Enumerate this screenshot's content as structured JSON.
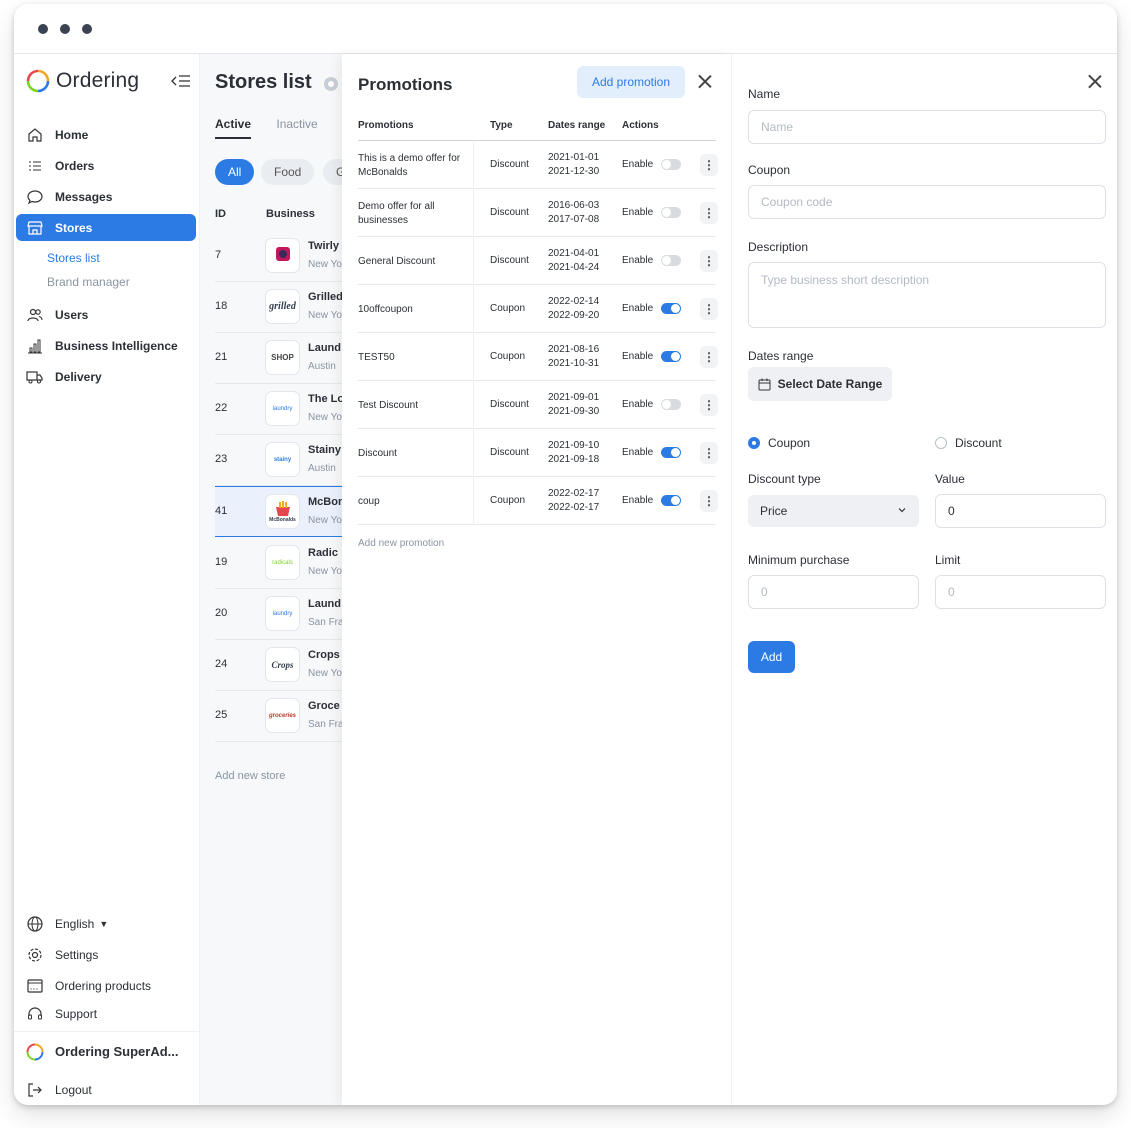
{
  "colors": {
    "accent": "#2c7be5",
    "accent_light": "#e3eefc",
    "text": "#2b2f36",
    "muted": "#8a94a2"
  },
  "sidebar": {
    "brand": "Ordering",
    "items": [
      {
        "label": "Home",
        "icon": "home-icon"
      },
      {
        "label": "Orders",
        "icon": "list-icon"
      },
      {
        "label": "Messages",
        "icon": "chat-icon"
      },
      {
        "label": "Stores",
        "icon": "store-icon",
        "active": true
      },
      {
        "label": "Users",
        "icon": "users-icon"
      },
      {
        "label": "Business Intelligence",
        "icon": "bar-chart-icon"
      },
      {
        "label": "Delivery",
        "icon": "truck-icon"
      }
    ],
    "sub_items": [
      {
        "label": "Stores list",
        "active": true
      },
      {
        "label": "Brand manager"
      }
    ],
    "bottom": {
      "language": "English",
      "settings": "Settings",
      "products": "Ordering products",
      "support": "Support",
      "account": "Ordering SuperAd...",
      "logout": "Logout"
    }
  },
  "stores": {
    "title": "Stores list",
    "tabs": [
      "Active",
      "Inactive"
    ],
    "chips": [
      "All",
      "Food",
      "G"
    ],
    "columns": [
      "ID",
      "Business"
    ],
    "rows": [
      {
        "id": "7",
        "name": "Twirly",
        "city": "New Yo",
        "logo": "twirly"
      },
      {
        "id": "18",
        "name": "Grilled",
        "city": "New Yo",
        "logo": "grilled"
      },
      {
        "id": "21",
        "name": "Laund",
        "city": "Austin",
        "logo": "SHOP"
      },
      {
        "id": "22",
        "name": "The Lo",
        "city": "New Yo",
        "logo": "laundry"
      },
      {
        "id": "23",
        "name": "Stainy",
        "city": "Austin",
        "logo": "stainy"
      },
      {
        "id": "41",
        "name": "McBon",
        "city": "New Yo",
        "logo": "McBonalds",
        "selected": true
      },
      {
        "id": "19",
        "name": "Radic",
        "city": "New Yo",
        "logo": "radicals"
      },
      {
        "id": "20",
        "name": "Laund",
        "city": "San Fra",
        "logo": "laundry"
      },
      {
        "id": "24",
        "name": "Crops",
        "city": "New Yo",
        "logo": "Crops"
      },
      {
        "id": "25",
        "name": "Groce",
        "city": "San Fra",
        "logo": "groceries"
      }
    ],
    "add_new": "Add new store"
  },
  "promotions": {
    "title": "Promotions",
    "add_button": "Add promotion",
    "columns": [
      "Promotions",
      "Type",
      "Dates range",
      "Actions"
    ],
    "rows": [
      {
        "name": "This is a demo offer for McBonalds",
        "type": "Discount",
        "start": "2021-01-01",
        "end": "2021-12-30",
        "action": "Enable",
        "enabled": false
      },
      {
        "name": "Demo offer for all businesses",
        "type": "Discount",
        "start": "2016-06-03",
        "end": "2017-07-08",
        "action": "Enable",
        "enabled": false
      },
      {
        "name": "General Discount",
        "type": "Discount",
        "start": "2021-04-01",
        "end": "2021-04-24",
        "action": "Enable",
        "enabled": false
      },
      {
        "name": "10offcoupon",
        "type": "Coupon",
        "start": "2022-02-14",
        "end": "2022-09-20",
        "action": "Enable",
        "enabled": true
      },
      {
        "name": "TEST50",
        "type": "Coupon",
        "start": "2021-08-16",
        "end": "2021-10-31",
        "action": "Enable",
        "enabled": true
      },
      {
        "name": "Test Discount",
        "type": "Discount",
        "start": "2021-09-01",
        "end": "2021-09-30",
        "action": "Enable",
        "enabled": false
      },
      {
        "name": "Discount",
        "type": "Discount",
        "start": "2021-09-10",
        "end": "2021-09-18",
        "action": "Enable",
        "enabled": true
      },
      {
        "name": "coup",
        "type": "Coupon",
        "start": "2022-02-17",
        "end": "2022-02-17",
        "action": "Enable",
        "enabled": true
      }
    ],
    "add_new": "Add new promotion"
  },
  "form": {
    "name_label": "Name",
    "name_placeholder": "Name",
    "coupon_label": "Coupon",
    "coupon_placeholder": "Coupon code",
    "description_label": "Description",
    "description_placeholder": "Type business short description",
    "dates_label": "Dates range",
    "dates_button": "Select Date Range",
    "radio_coupon": "Coupon",
    "radio_discount": "Discount",
    "selected_radio": "Coupon",
    "discount_type_label": "Discount type",
    "discount_type_value": "Price",
    "value_label": "Value",
    "value_value": "0",
    "min_purchase_label": "Minimum purchase",
    "min_purchase_placeholder": "0",
    "limit_label": "Limit",
    "limit_placeholder": "0",
    "submit": "Add"
  }
}
